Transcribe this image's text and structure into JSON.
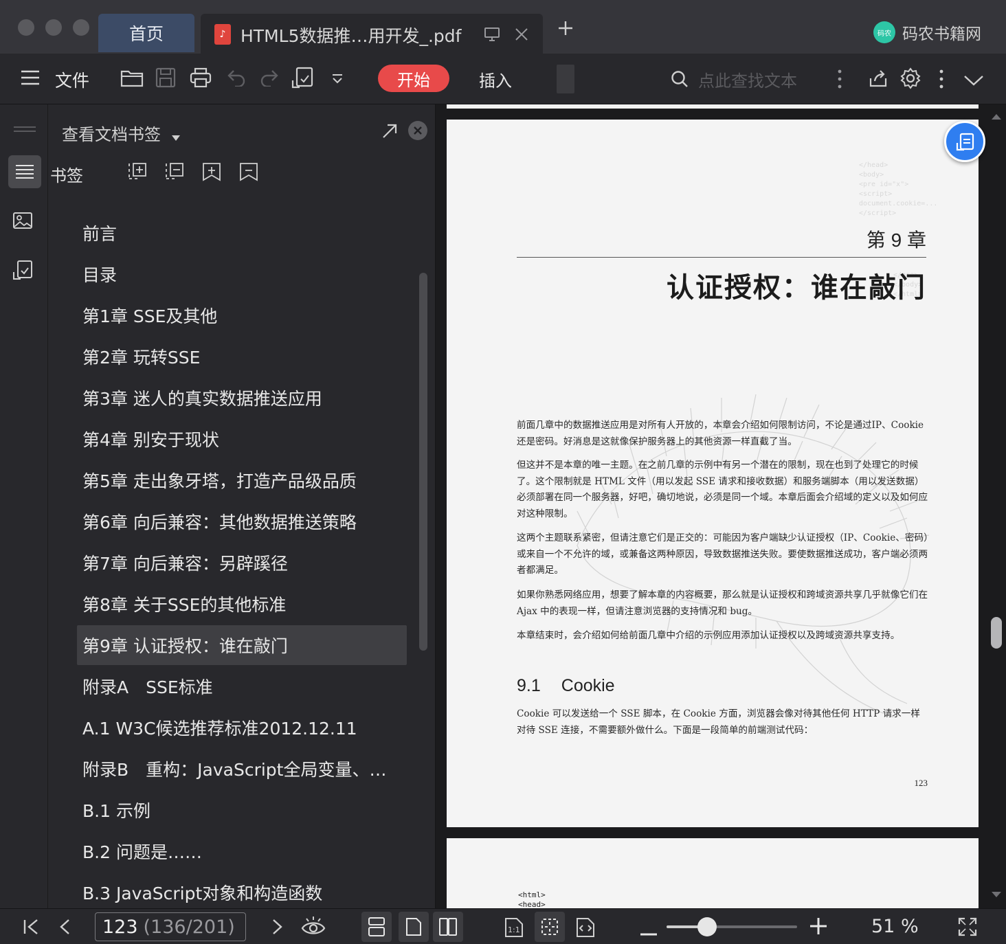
{
  "titlebar": {
    "home_tab": "首页",
    "doc_tab": "HTML5数据推…用开发_.pdf",
    "brand": "码农书籍网",
    "brand_logo_text": "码农"
  },
  "toolbar": {
    "menu_label": "文件",
    "start_label": "开始",
    "insert_label": "插入",
    "search_placeholder": "点此查找文本"
  },
  "panel": {
    "title": "查看文档书签",
    "sub_label": "书签",
    "items": [
      {
        "label": "前言",
        "arrow": false,
        "selected": false
      },
      {
        "label": "目录",
        "arrow": false,
        "selected": false
      },
      {
        "label": "第1章 SSE及其他",
        "arrow": true,
        "selected": false
      },
      {
        "label": "第2章 玩转SSE",
        "arrow": true,
        "selected": false
      },
      {
        "label": "第3章 迷人的真实数据推送应用",
        "arrow": true,
        "selected": false
      },
      {
        "label": "第4章 别安于现状",
        "arrow": true,
        "selected": false
      },
      {
        "label": "第5章 走出象牙塔，打造产品级品质",
        "arrow": true,
        "selected": false
      },
      {
        "label": "第6章 向后兼容：其他数据推送策略",
        "arrow": true,
        "selected": false
      },
      {
        "label": "第7章 向后兼容：另辟蹊径",
        "arrow": true,
        "selected": false
      },
      {
        "label": "第8章 关于SSE的其他标准",
        "arrow": true,
        "selected": false
      },
      {
        "label": "第9章 认证授权：谁在敲门",
        "arrow": true,
        "selected": true
      },
      {
        "label": "附录A　SSE标准",
        "arrow": false,
        "selected": false
      },
      {
        "label": "A.1 W3C候选推荐标准2012.12.11",
        "arrow": true,
        "selected": false
      },
      {
        "label": "附录B　重构：JavaScript全局变量、…",
        "arrow": false,
        "selected": false
      },
      {
        "label": "B.1 示例",
        "arrow": false,
        "selected": false
      },
      {
        "label": "B.2 问题是……",
        "arrow": false,
        "selected": false
      },
      {
        "label": "B.3 JavaScript对象和构造函数",
        "arrow": false,
        "selected": false
      }
    ]
  },
  "page": {
    "chapter_number": "第 9 章",
    "chapter_title": "认证授权：谁在敲门",
    "paragraphs": [
      "前面几章中的数据推送应用是对所有人开放的，本章会介绍如何限制访问，不论是通过IP、Cookie 还是密码。好消息是这就像保护服务器上的其他资源一样直截了当。",
      "但这并不是本章的唯一主题。在之前几章的示例中有另一个潜在的限制，现在也到了处理它的时候了。这个限制就是 HTML 文件（用以发起 SSE 请求和接收数据）和服务端脚本（用以发送数据）必须部署在同一个服务器，好吧，确切地说，必须是同一个域。本章后面会介绍域的定义以及如何应对这种限制。",
      "这两个主题联系紧密，但请注意它们是正交的：可能因为客户端缺少认证授权（IP、Cookie、密码）或来自一个不允许的域，或兼备这两种原因，导致数据推送失败。要使数据推送成功，客户端必须两者都满足。",
      "如果你熟悉网络应用，想要了解本章的内容概要，那么就是认证授权和跨域资源共享几乎就像它们在 Ajax 中的表现一样，但请注意浏览器的支持情况和 bug。",
      "本章结束时，会介绍如何给前面几章中介绍的示例应用添加认证授权以及跨域资源共享支持。"
    ],
    "section_number": "9.1",
    "section_title": "Cookie",
    "section_para": "Cookie 可以发送给一个 SSE 脚本，在 Cookie 方面，浏览器会像对待其他任何 HTTP 请求一样对待 SSE 连接，不需要额外做什么。下面是一段简单的前端测试代码：",
    "page_number": "123"
  },
  "next_page": {
    "code_lines": [
      "<html>",
      "<head>"
    ]
  },
  "statusbar": {
    "current_page": "123",
    "page_total": "(136/201)",
    "zoom": "51 %",
    "zoom_level": 0.31
  }
}
